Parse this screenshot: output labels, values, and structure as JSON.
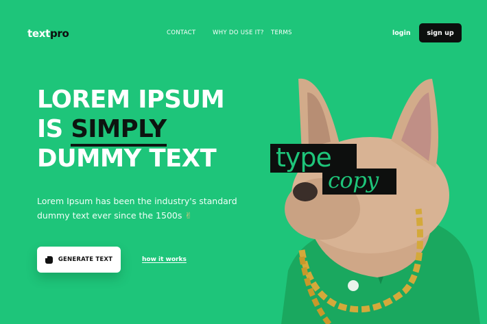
{
  "header": {
    "logo_text": "text",
    "logo_pro": "pro",
    "nav": [
      "CONTACT",
      "WHY DO USE IT?",
      "TERMS"
    ],
    "login": "login",
    "signup": "sign up"
  },
  "hero": {
    "line1": "LOREM IPSUM",
    "line2_prefix": "IS ",
    "line2_highlight": "SIMPLY",
    "line3": "DUMMY TEXT",
    "subtext": "Lorem Ipsum has been the industry's standard dummy text ever since the 1500s",
    "subtext_emoji": "✌",
    "generate_button": "GENERATE TEXT",
    "how_link": "how it works"
  },
  "art": {
    "label_type": "type",
    "label_copy": "copy"
  },
  "colors": {
    "background": "#1ec57a",
    "dark": "#0d0f0e",
    "jacket": "#1aa85f",
    "chain": "#d4a93a"
  }
}
